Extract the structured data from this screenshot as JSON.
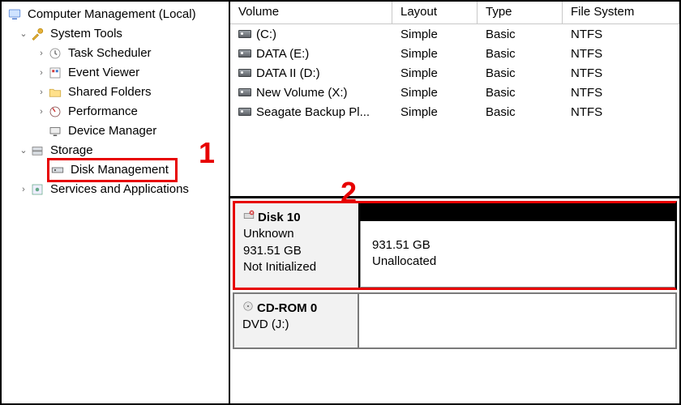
{
  "tree": {
    "root": "Computer Management (Local)",
    "system_tools": "System Tools",
    "task_scheduler": "Task Scheduler",
    "event_viewer": "Event Viewer",
    "shared_folders": "Shared Folders",
    "performance": "Performance",
    "device_manager": "Device Manager",
    "storage": "Storage",
    "disk_management": "Disk Management",
    "services_apps": "Services and Applications"
  },
  "volumes": {
    "headers": {
      "volume": "Volume",
      "layout": "Layout",
      "type": "Type",
      "fs": "File System"
    },
    "rows": [
      {
        "name": "(C:)",
        "layout": "Simple",
        "type": "Basic",
        "fs": "NTFS"
      },
      {
        "name": "DATA (E:)",
        "layout": "Simple",
        "type": "Basic",
        "fs": "NTFS"
      },
      {
        "name": "DATA II (D:)",
        "layout": "Simple",
        "type": "Basic",
        "fs": "NTFS"
      },
      {
        "name": "New Volume (X:)",
        "layout": "Simple",
        "type": "Basic",
        "fs": "NTFS"
      },
      {
        "name": "Seagate Backup Pl...",
        "layout": "Simple",
        "type": "Basic",
        "fs": "NTFS"
      }
    ]
  },
  "disk10": {
    "name": "Disk 10",
    "status1": "Unknown",
    "size": "931.51 GB",
    "status2": "Not Initialized",
    "part_size": "931.51 GB",
    "part_status": "Unallocated"
  },
  "cdrom": {
    "name": "CD-ROM 0",
    "sub": "DVD (J:)"
  },
  "annot": {
    "one": "1",
    "two": "2"
  }
}
